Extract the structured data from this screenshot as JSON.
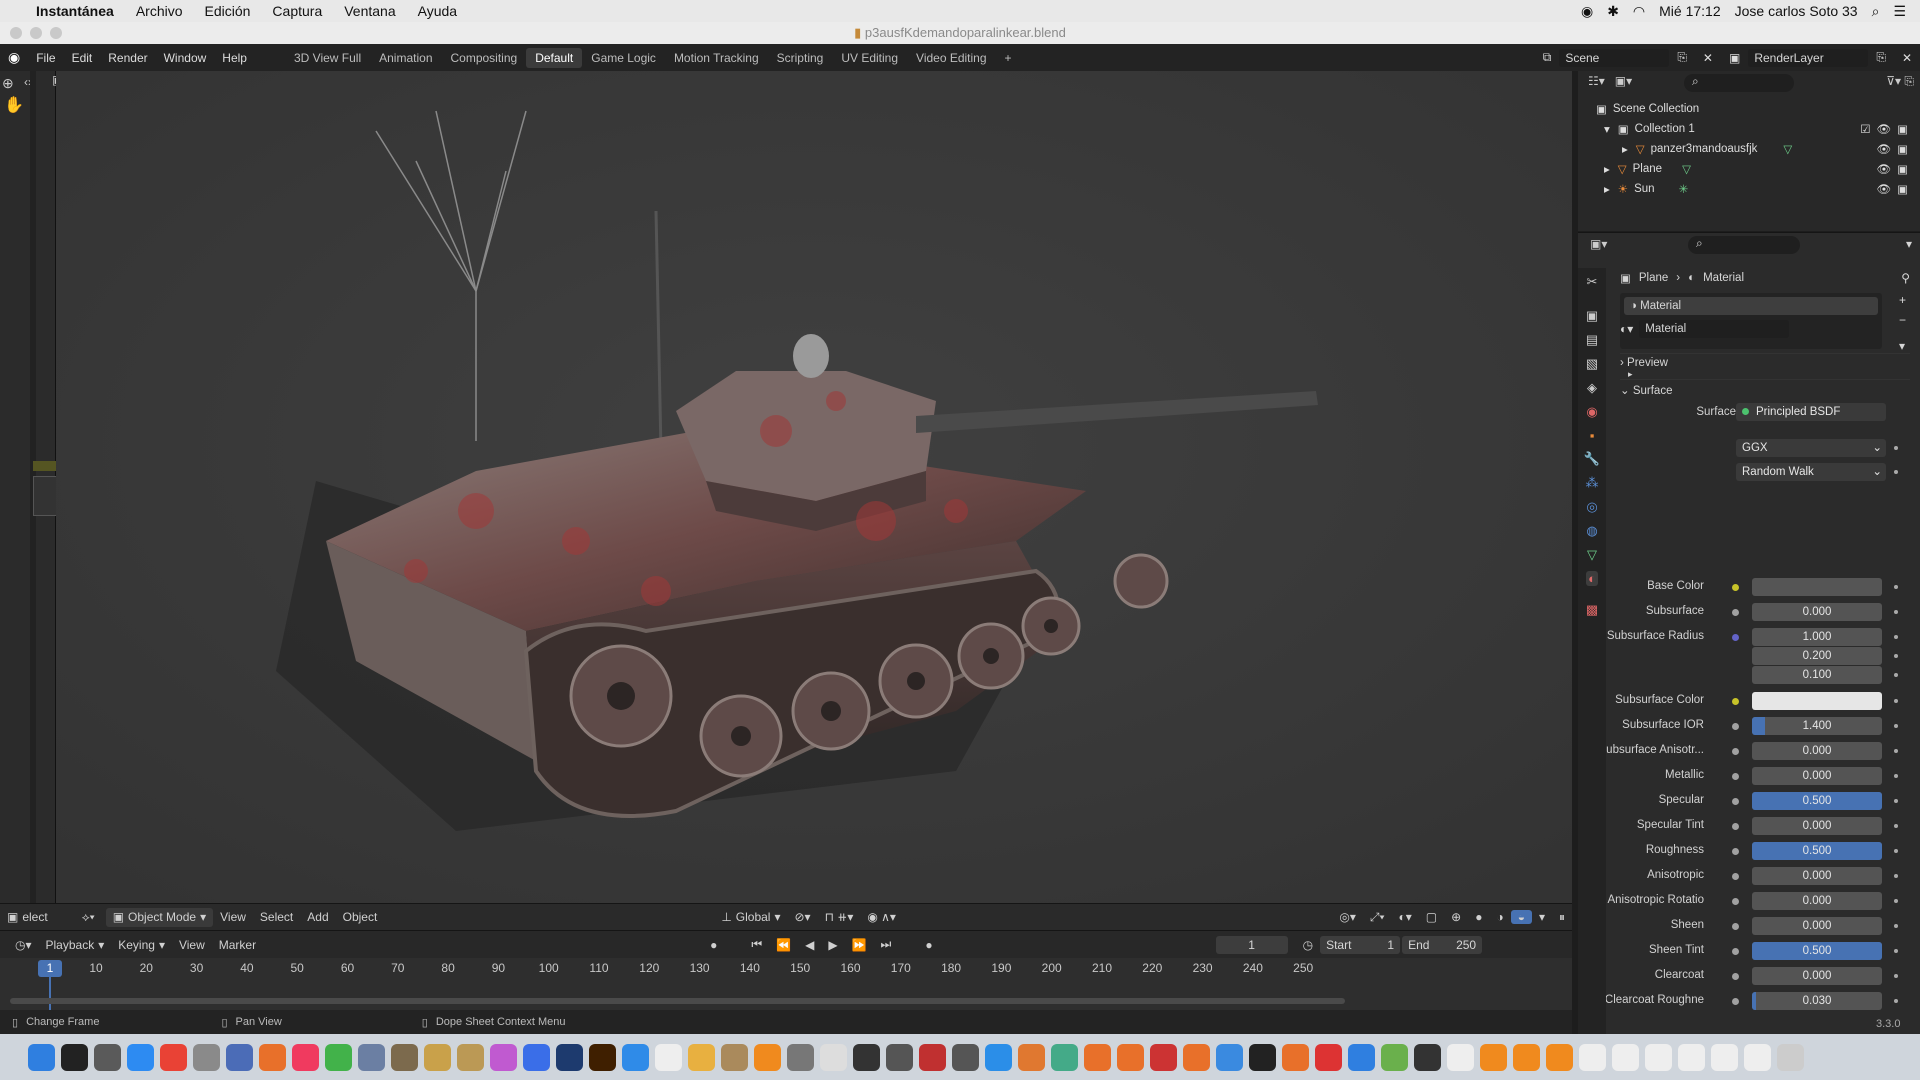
{
  "mac_menu": {
    "app": "Instantánea",
    "items": [
      "Archivo",
      "Edición",
      "Captura",
      "Ventana",
      "Ayuda"
    ],
    "clock": "Mié 17:12",
    "user": "Jose carlos Soto 33"
  },
  "window": {
    "title": "p3ausfKdemandoparalinkear.blend"
  },
  "blender_menu": [
    "File",
    "Edit",
    "Render",
    "Window",
    "Help"
  ],
  "workspaces": [
    "3D View Full",
    "Animation",
    "Compositing",
    "Default",
    "Game Logic",
    "Motion Tracking",
    "Scripting",
    "UV Editing",
    "Video Editing"
  ],
  "active_workspace": "Default",
  "add_workspace": "+",
  "scene": {
    "label": "Scene",
    "render_layer": "RenderLayer"
  },
  "outliner": {
    "root": "Scene Collection",
    "collection": "Collection 1",
    "objects": [
      "panzer3mandoausfjk",
      "Plane",
      "Sun"
    ]
  },
  "viewport_header": {
    "select": "elect",
    "mode": "Object Mode",
    "menus": [
      "View",
      "Select",
      "Add",
      "Object"
    ],
    "orientation": "Global"
  },
  "timeline_header": {
    "menus": [
      "Playback",
      "Keying",
      "View",
      "Marker"
    ],
    "current_frame": "1",
    "start_label": "Start",
    "start": "1",
    "end_label": "End",
    "end": "250"
  },
  "ruler": {
    "current": "1",
    "ticks": [
      "10",
      "20",
      "30",
      "40",
      "50",
      "60",
      "70",
      "80",
      "90",
      "100",
      "110",
      "120",
      "130",
      "140",
      "150",
      "160",
      "170",
      "180",
      "190",
      "200",
      "210",
      "220",
      "230",
      "240",
      "250"
    ]
  },
  "status": {
    "left": "Change Frame",
    "mid": "Pan View",
    "right": "Dope Sheet Context Menu",
    "version": "3.3.0"
  },
  "properties": {
    "breadcrumb": [
      "Plane",
      "Material"
    ],
    "slot": "Material",
    "material_name": "Material",
    "preview": "Preview",
    "surface_panel": "Surface",
    "surface_label": "Surface",
    "surface_shader": "Principled BSDF",
    "distribution": "GGX",
    "subsurface_method": "Random Walk",
    "params": [
      {
        "label": "Base Color",
        "value": "",
        "socket": "#c7c329",
        "kind": "color",
        "color": "#555555"
      },
      {
        "label": "Subsurface",
        "value": "0.000",
        "socket": "#a1a1a1",
        "kind": "num",
        "fill": 0
      },
      {
        "label": "Subsurface Radius",
        "value": "1.000",
        "socket": "#6363c7",
        "kind": "num",
        "fill": 0
      },
      {
        "label": "",
        "value": "0.200",
        "socket": "",
        "kind": "num",
        "fill": 0
      },
      {
        "label": "",
        "value": "0.100",
        "socket": "",
        "kind": "num",
        "fill": 0
      },
      {
        "label": "Subsurface Color",
        "value": "",
        "socket": "#c7c329",
        "kind": "color",
        "color": "#e6e6e6"
      },
      {
        "label": "Subsurface IOR",
        "value": "1.400",
        "socket": "#a1a1a1",
        "kind": "num",
        "fill": 0.1
      },
      {
        "label": "Subsurface Anisotr...",
        "value": "0.000",
        "socket": "#a1a1a1",
        "kind": "num",
        "fill": 0
      },
      {
        "label": "Metallic",
        "value": "0.000",
        "socket": "#a1a1a1",
        "kind": "num",
        "fill": 0
      },
      {
        "label": "Specular",
        "value": "0.500",
        "socket": "#a1a1a1",
        "kind": "num",
        "fill": 1
      },
      {
        "label": "Specular Tint",
        "value": "0.000",
        "socket": "#a1a1a1",
        "kind": "num",
        "fill": 0
      },
      {
        "label": "Roughness",
        "value": "0.500",
        "socket": "#a1a1a1",
        "kind": "num",
        "fill": 1
      },
      {
        "label": "Anisotropic",
        "value": "0.000",
        "socket": "#a1a1a1",
        "kind": "num",
        "fill": 0
      },
      {
        "label": "Anisotropic Rotatio",
        "value": "0.000",
        "socket": "#a1a1a1",
        "kind": "num",
        "fill": 0
      },
      {
        "label": "Sheen",
        "value": "0.000",
        "socket": "#a1a1a1",
        "kind": "num",
        "fill": 0
      },
      {
        "label": "Sheen Tint",
        "value": "0.500",
        "socket": "#a1a1a1",
        "kind": "num",
        "fill": 1
      },
      {
        "label": "Clearcoat",
        "value": "0.000",
        "socket": "#a1a1a1",
        "kind": "num",
        "fill": 0
      },
      {
        "label": "Clearcoat Roughne",
        "value": "0.030",
        "socket": "#a1a1a1",
        "kind": "num",
        "fill": 0.03
      }
    ]
  },
  "colors": {
    "accent": "#4772b3",
    "menubar": "#e8e8e8",
    "panel": "#2b2b2b",
    "viewport": "#3b3b3b"
  }
}
